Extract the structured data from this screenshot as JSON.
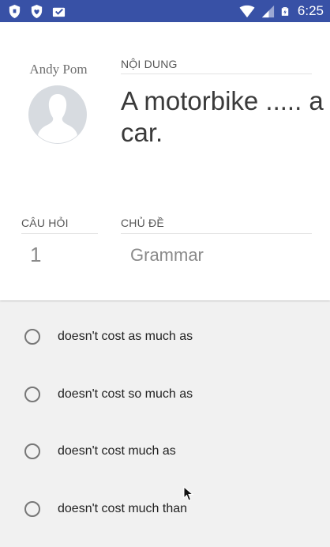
{
  "status_bar": {
    "time": "6:25",
    "left_icons": [
      "shield-icon",
      "heart-badge-icon",
      "inbox-check-icon"
    ],
    "right_icons": [
      "wifi-icon",
      "cell-signal-icon",
      "battery-icon"
    ]
  },
  "author": {
    "name": "Andy Pom"
  },
  "content": {
    "label": "NỘI DUNG",
    "question": "A motorbike ..... a car."
  },
  "question_number": {
    "label": "CÂU HỎI",
    "value": "1"
  },
  "topic": {
    "label": "CHỦ ĐỀ",
    "value": "Grammar"
  },
  "options": [
    {
      "label": "doesn't cost as much as",
      "selected": false
    },
    {
      "label": "doesn't cost so much as",
      "selected": false
    },
    {
      "label": "doesn't cost much as",
      "selected": false
    },
    {
      "label": "doesn't cost much than",
      "selected": false
    }
  ],
  "colors": {
    "status_bar": "#3851a6",
    "card": "#ffffff",
    "background": "#f1f1f1"
  }
}
